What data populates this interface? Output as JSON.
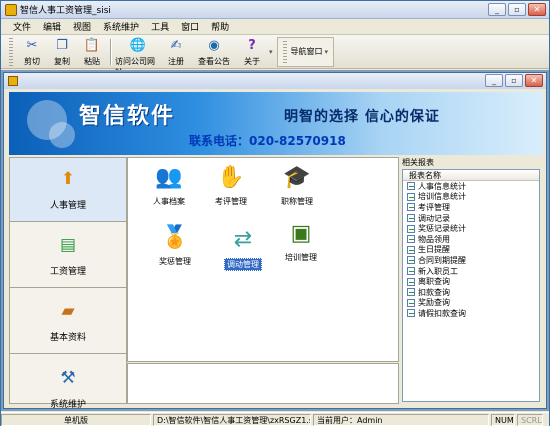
{
  "window": {
    "title": "智信人事工资管理_sisi"
  },
  "menu": [
    "文件",
    "编辑",
    "视图",
    "系统维护",
    "工具",
    "窗口",
    "帮助"
  ],
  "toolbar": {
    "buttons": [
      {
        "label": "剪切",
        "icon": "scissors-icon",
        "glyph": "✂"
      },
      {
        "label": "复制",
        "icon": "copy-icon",
        "glyph": "❐"
      },
      {
        "label": "粘贴",
        "icon": "paste-icon",
        "glyph": "📋"
      },
      {
        "label": "访问公司网站",
        "icon": "globe-link-icon",
        "glyph": "🌐"
      },
      {
        "label": "注册",
        "icon": "register-icon",
        "glyph": "✍"
      },
      {
        "label": "查看公告",
        "icon": "globe-icon",
        "glyph": "◉"
      },
      {
        "label": "关于",
        "icon": "help-icon",
        "glyph": "?"
      }
    ],
    "nav_window_label": "导航窗口"
  },
  "banner": {
    "logo_text": "智信软件",
    "slogan": "明智的选择 信心的保证",
    "phone": "联系电话：020-82570918"
  },
  "left_nav": [
    {
      "label": "人事管理",
      "icon": "hr-management-icon",
      "glyph": "⬆",
      "active": true
    },
    {
      "label": "工资管理",
      "icon": "salary-icon",
      "glyph": "▤",
      "active": false
    },
    {
      "label": "基本资料",
      "icon": "book-icon",
      "glyph": "▰",
      "active": false
    },
    {
      "label": "系统维护",
      "icon": "tools-icon",
      "glyph": "⚒",
      "active": false
    }
  ],
  "modules": [
    {
      "label": "人事档案",
      "icon": "people-icon",
      "glyph": "👥",
      "selected": false
    },
    {
      "label": "考评管理",
      "icon": "evaluation-icon",
      "glyph": "✋",
      "selected": false
    },
    {
      "label": "职称管理",
      "icon": "graduate-icon",
      "glyph": "🎓",
      "selected": false
    },
    {
      "label": "奖惩管理",
      "icon": "medal-icon",
      "glyph": "🏅",
      "selected": false
    },
    {
      "label": "调动管理",
      "icon": "transfer-icon",
      "glyph": "⇄",
      "selected": true
    },
    {
      "label": "培训管理",
      "icon": "training-icon",
      "glyph": "▣",
      "selected": false
    }
  ],
  "reports": {
    "title": "相关报表",
    "column": "报表名称",
    "items": [
      "人事信息统计",
      "培训信息统计",
      "考评管理",
      "调动记录",
      "奖惩记录统计",
      "物品领用",
      "生日提醒",
      "合同到期提醒",
      "新入职员工",
      "离职查询",
      "扣款查询",
      "奖励查询",
      "请假扣款查询"
    ]
  },
  "status": {
    "mode": "单机版",
    "path": "D:\\智信软件\\智信人事工资管理\\zxRSGZ1.sys",
    "user": "当前用户：Admin",
    "num": "NUM",
    "scrl": "SCRL"
  }
}
